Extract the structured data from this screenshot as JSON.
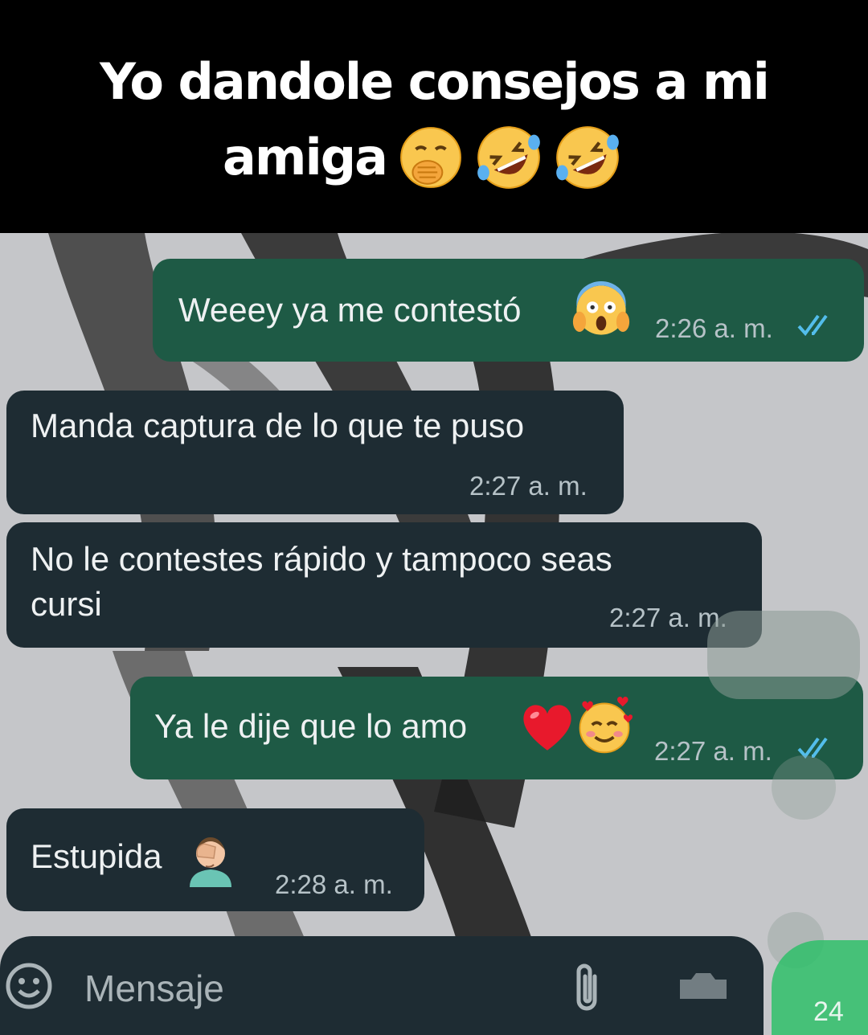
{
  "caption": {
    "line1": "Yo dandole consejos a mi",
    "line2": "amiga"
  },
  "messages": [
    {
      "direction": "outgoing",
      "text": "Weeey ya me contestó",
      "time": "2:26 a. m."
    },
    {
      "direction": "incoming",
      "text": "Manda captura de lo que te puso",
      "time": "2:27 a. m."
    },
    {
      "direction": "incoming",
      "text_line1": "No le contestes rápido y tampoco seas",
      "text_line2": "cursi",
      "time": "2:27 a. m."
    },
    {
      "direction": "outgoing",
      "text": "Ya le dije que lo amo",
      "time": "2:27 a. m."
    },
    {
      "direction": "incoming",
      "text": "Estupida",
      "time": "2:28 a. m."
    }
  ],
  "composer": {
    "placeholder": "Mensaje",
    "badge": "24"
  },
  "icons": [
    "hand-over-mouth-emoji",
    "rolling-laughing-emoji",
    "screaming-face-emoji",
    "red-heart-emoji",
    "smiling-hearts-emoji",
    "facepalm-emoji",
    "double-check-icon",
    "smiley-icon",
    "paperclip-icon",
    "camera-icon"
  ],
  "colors": {
    "outgoing_bubble": "#1e5a45",
    "incoming_bubble": "#1e2c33",
    "read_ticks": "#53bdeb",
    "caption_bg": "#000000"
  }
}
